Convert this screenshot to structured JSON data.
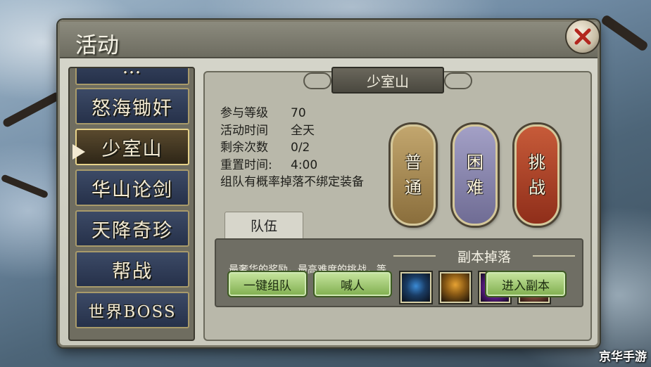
{
  "window": {
    "title": "活动"
  },
  "sidebar": {
    "items": [
      {
        "label": "…",
        "selected": false
      },
      {
        "label": "怒海锄奸",
        "selected": false
      },
      {
        "label": "少室山",
        "selected": true
      },
      {
        "label": "华山论剑",
        "selected": false
      },
      {
        "label": "天降奇珍",
        "selected": false
      },
      {
        "label": "帮战",
        "selected": false
      },
      {
        "label": "世界BOSS",
        "selected": false
      }
    ]
  },
  "main": {
    "title": "少室山",
    "info": [
      {
        "key": "参与等级",
        "value": "70"
      },
      {
        "key": "活动时间",
        "value": "全天"
      },
      {
        "key": "剩余次数",
        "value": "0/2"
      },
      {
        "key": "重置时间:",
        "value": "4:00"
      }
    ],
    "note": "组队有概率掉落不绑定装备",
    "difficulty": [
      {
        "label_top": "普",
        "label_bottom": "通"
      },
      {
        "label_top": "困",
        "label_bottom": "难"
      },
      {
        "label_top": "挑",
        "label_bottom": "战"
      }
    ],
    "team": {
      "tab_label": "队伍",
      "description": "最奢华的奖励，最高难度的挑战，等待着你们组队前来",
      "drops_title": "副本掉落",
      "drops": [
        "armor-item-icon",
        "helmet-item-icon",
        "orb-item-icon",
        "portrait-item-icon"
      ]
    },
    "buttons": {
      "onekey": "一键组队",
      "shout": "喊人",
      "enter": "进入副本"
    }
  },
  "watermark": "京华手游"
}
